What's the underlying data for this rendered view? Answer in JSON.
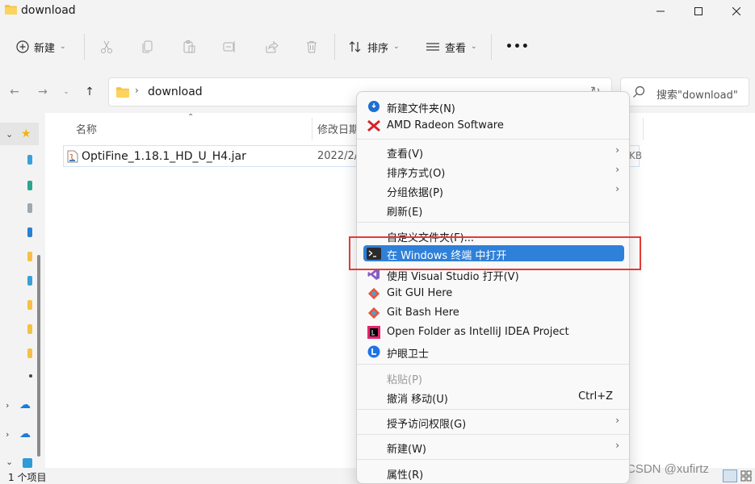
{
  "window": {
    "title": "download"
  },
  "toolbar": {
    "new_label": "新建",
    "sort_label": "排序",
    "view_label": "查看",
    "more_label": "•••"
  },
  "address": {
    "crumb": "download",
    "search_placeholder": "搜索\"download\""
  },
  "columns": {
    "name": "名称",
    "modified": "修改日期"
  },
  "files": [
    {
      "name": "OptiFine_1.18.1_HD_U_H4.jar",
      "date": "2022/2/",
      "size": "KB"
    }
  ],
  "status": {
    "count": "1 个项目"
  },
  "watermark": "CSDN @xufirtz",
  "context_menu": {
    "items": [
      {
        "label": "新建文件夹(N)",
        "icon": "new-folder-icon"
      },
      {
        "label": "AMD Radeon Software",
        "icon": "amd-radeon-icon"
      },
      {
        "label": "查看(V)",
        "submenu": true
      },
      {
        "label": "排序方式(O)",
        "submenu": true
      },
      {
        "label": "分组依据(P)",
        "submenu": true
      },
      {
        "label": "刷新(E)"
      },
      {
        "label": "自定义文件夹(F)..."
      },
      {
        "label": "在 Windows 终端 中打开",
        "icon": "windows-terminal-icon",
        "highlighted": true
      },
      {
        "label": "使用 Visual Studio 打开(V)",
        "icon": "visual-studio-icon"
      },
      {
        "label": "Git GUI Here",
        "icon": "git-icon"
      },
      {
        "label": "Git Bash Here",
        "icon": "git-icon"
      },
      {
        "label": "Open Folder as IntelliJ IDEA Project",
        "icon": "intellij-icon"
      },
      {
        "label": "护眼卫士",
        "icon": "eye-guard-icon"
      },
      {
        "label": "粘贴(P)",
        "disabled": true
      },
      {
        "label": "撤消 移动(U)",
        "shortcut": "Ctrl+Z"
      },
      {
        "label": "授予访问权限(G)",
        "submenu": true
      },
      {
        "label": "新建(W)",
        "submenu": true
      },
      {
        "label": "属性(R)"
      }
    ]
  }
}
